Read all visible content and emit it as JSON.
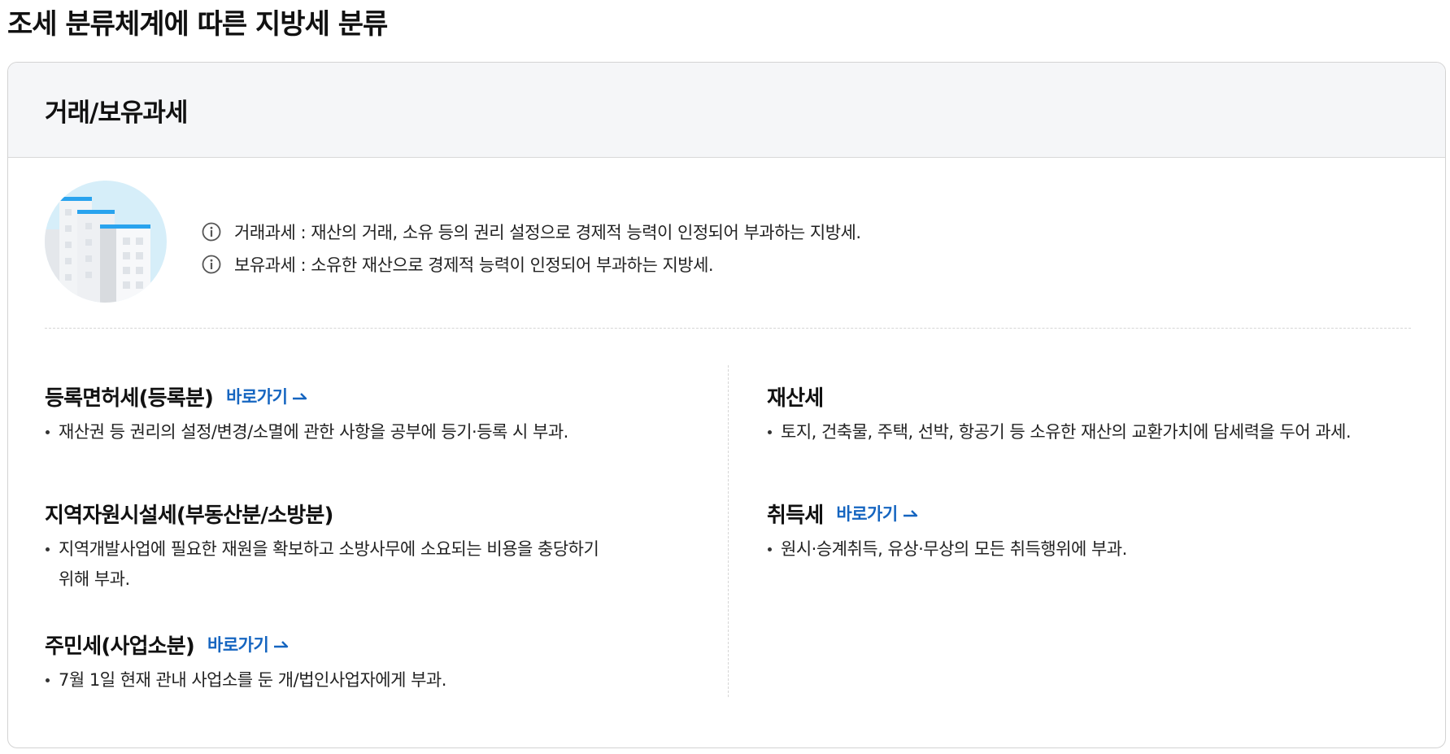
{
  "page": {
    "title": "조세 분류체계에 따른 지방세 분류"
  },
  "card": {
    "title": "거래/보유과세",
    "illustration": "building-icon",
    "notes": [
      {
        "icon": "info-icon",
        "text": "거래과세 : 재산의 거래, 소유 등의 권리 설정으로 경제적 능력이 인정되어 부과하는 지방세."
      },
      {
        "icon": "info-icon",
        "text": "보유과세 : 소유한 재산으로 경제적 능력이 인정되어 부과하는 지방세."
      }
    ]
  },
  "left_items": [
    {
      "title": "등록면허세(등록분)",
      "link": "바로가기",
      "desc": "재산권 등 권리의 설정/변경/소멸에 관한 사항을 공부에 등기·등록 시 부과."
    },
    {
      "title": "지역자원시설세(부동산분/소방분)",
      "link": "",
      "desc": "지역개발사업에 필요한 재원을 확보하고 소방사무에 소요되는 비용을 충당하기 위해 부과."
    },
    {
      "title": "주민세(사업소분)",
      "link": "바로가기",
      "desc": "7월 1일 현재 관내 사업소를 둔 개/법인사업자에게 부과."
    }
  ],
  "right_items": [
    {
      "title": "재산세",
      "link": "",
      "desc": "토지, 건축물, 주택, 선박, 항공기 등 소유한 재산의 교환가치에 담세력을 두어 과세."
    },
    {
      "title": "취득세",
      "link": "바로가기",
      "desc": "원시·승계취득, 유상·무상의 모든 취득행위에 부과."
    }
  ],
  "colors": {
    "link": "#1565c0",
    "header_bg": "#f5f6f8",
    "illustration_sky": "#d6eef9",
    "building_accent": "#29a3ee"
  }
}
